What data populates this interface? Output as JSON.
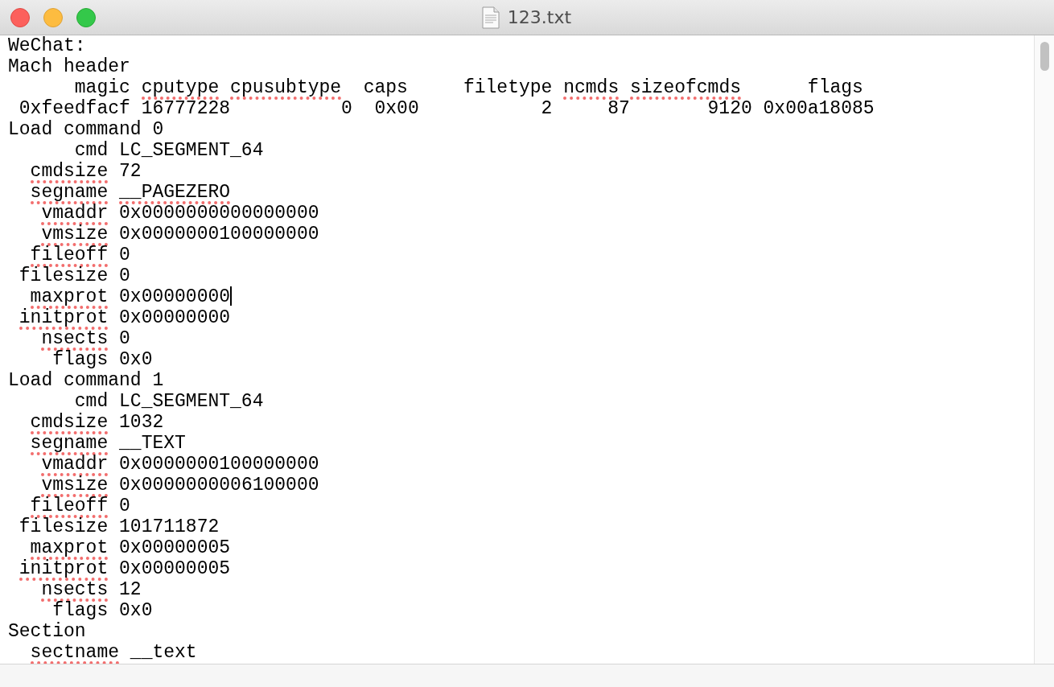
{
  "window": {
    "title": "123.txt"
  },
  "document": {
    "lines": [
      {
        "segments": [
          {
            "text": "WeChat:"
          }
        ]
      },
      {
        "segments": [
          {
            "text": "Mach header"
          }
        ]
      },
      {
        "segments": [
          {
            "text": "      magic"
          },
          {
            "text": " cputype",
            "misspelled": true
          },
          {
            "text": " cpusubtype",
            "misspelled": true
          },
          {
            "text": "  caps     filetype"
          },
          {
            "text": " ncmds",
            "misspelled": true
          },
          {
            "text": " sizeofcmds",
            "misspelled": true
          },
          {
            "text": "      flags"
          }
        ]
      },
      {
        "segments": [
          {
            "text": " 0xfeedfacf 16777228          0  0x00           2     87       9120 0x00a18085"
          }
        ]
      },
      {
        "segments": [
          {
            "text": "Load command 0"
          }
        ]
      },
      {
        "segments": [
          {
            "text": "      cmd LC_SEGMENT_64"
          }
        ]
      },
      {
        "segments": [
          {
            "text": "  cmdsize",
            "misspelled": true
          },
          {
            "text": " 72"
          }
        ]
      },
      {
        "segments": [
          {
            "text": "  segname",
            "misspelled": true
          },
          {
            "text": " __PAGEZERO",
            "misspelled": true
          }
        ]
      },
      {
        "segments": [
          {
            "text": "   vmaddr",
            "misspelled": true
          },
          {
            "text": " 0x0000000000000000"
          }
        ]
      },
      {
        "segments": [
          {
            "text": "   vmsize",
            "misspelled": true
          },
          {
            "text": " 0x0000000100000000"
          }
        ]
      },
      {
        "segments": [
          {
            "text": "  fileoff",
            "misspelled": true
          },
          {
            "text": " 0"
          }
        ]
      },
      {
        "segments": [
          {
            "text": " filesize 0"
          }
        ]
      },
      {
        "segments": [
          {
            "text": "  maxprot",
            "misspelled": true
          },
          {
            "text": " 0x00000000"
          }
        ],
        "cursor": true
      },
      {
        "segments": [
          {
            "text": " initprot",
            "misspelled": true
          },
          {
            "text": " 0x00000000"
          }
        ]
      },
      {
        "segments": [
          {
            "text": "   nsects",
            "misspelled": true
          },
          {
            "text": " 0"
          }
        ]
      },
      {
        "segments": [
          {
            "text": "    flags 0x0"
          }
        ]
      },
      {
        "segments": [
          {
            "text": "Load command 1"
          }
        ]
      },
      {
        "segments": [
          {
            "text": "      cmd LC_SEGMENT_64"
          }
        ]
      },
      {
        "segments": [
          {
            "text": "  cmdsize",
            "misspelled": true
          },
          {
            "text": " 1032"
          }
        ]
      },
      {
        "segments": [
          {
            "text": "  segname",
            "misspelled": true
          },
          {
            "text": " __TEXT"
          }
        ]
      },
      {
        "segments": [
          {
            "text": "   vmaddr",
            "misspelled": true
          },
          {
            "text": " 0x0000000100000000"
          }
        ]
      },
      {
        "segments": [
          {
            "text": "   vmsize",
            "misspelled": true
          },
          {
            "text": " 0x0000000006100000"
          }
        ]
      },
      {
        "segments": [
          {
            "text": "  fileoff",
            "misspelled": true
          },
          {
            "text": " 0"
          }
        ]
      },
      {
        "segments": [
          {
            "text": " filesize 101711872"
          }
        ]
      },
      {
        "segments": [
          {
            "text": "  maxprot",
            "misspelled": true
          },
          {
            "text": " 0x00000005"
          }
        ]
      },
      {
        "segments": [
          {
            "text": " initprot",
            "misspelled": true
          },
          {
            "text": " 0x00000005"
          }
        ]
      },
      {
        "segments": [
          {
            "text": "   nsects",
            "misspelled": true
          },
          {
            "text": " 12"
          }
        ]
      },
      {
        "segments": [
          {
            "text": "    flags 0x0"
          }
        ]
      },
      {
        "segments": [
          {
            "text": "Section"
          }
        ]
      },
      {
        "segments": [
          {
            "text": "  sectname",
            "misspelled": true
          },
          {
            "text": " __text"
          }
        ]
      }
    ]
  }
}
